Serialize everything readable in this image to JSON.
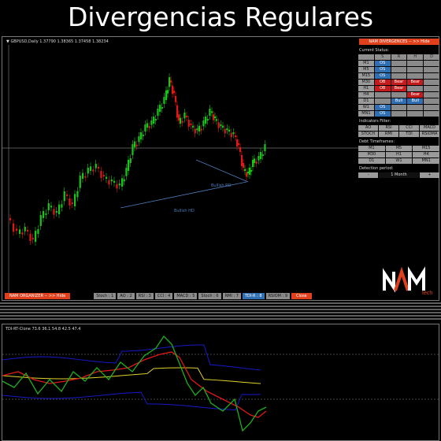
{
  "header": {
    "title": "Divergencias Regulares"
  },
  "chart": {
    "symbol_line": "GBPUSD,Daily  1.37790 1.38365 1.37458 1.38234",
    "annotations": [
      "Bullish RD",
      "Bullish HD"
    ]
  },
  "panel": {
    "title": "NAM DIVERGENCES -- >> Hide",
    "current_status_label": "Current Status:",
    "columns": [
      "",
      "S",
      "R",
      "H",
      "D"
    ],
    "rows": [
      {
        "tf": "M1",
        "cells": [
          "OS",
          "",
          "",
          ""
        ]
      },
      {
        "tf": "M5",
        "cells": [
          "OS",
          "",
          "",
          ""
        ]
      },
      {
        "tf": "M15",
        "cells": [
          "OS",
          "",
          "",
          ""
        ]
      },
      {
        "tf": "M30",
        "cells": [
          "OB",
          "Bear",
          "Bear",
          ""
        ]
      },
      {
        "tf": "H1",
        "cells": [
          "OB",
          "Bear",
          "",
          ""
        ]
      },
      {
        "tf": "H4",
        "cells": [
          "",
          "",
          "Bear",
          ""
        ]
      },
      {
        "tf": "D1",
        "cells": [
          "",
          "Bull",
          "Bull",
          ""
        ]
      },
      {
        "tf": "W1",
        "cells": [
          "OS",
          "",
          "",
          ""
        ]
      },
      {
        "tf": "MN1",
        "cells": [
          "OS",
          "",
          "",
          ""
        ]
      }
    ],
    "filter_label": "Indicators Filter:",
    "filters": [
      "AO",
      "RSI",
      "CCI",
      "MACD",
      "STOCH",
      "RMI",
      "TDI",
      "RSIOMA"
    ],
    "debt_label": "Debt Timeframes:",
    "timeframes": [
      "M1",
      "M5",
      "M15",
      "M30",
      "H1",
      "H4",
      "D1",
      "W1",
      "MN1"
    ],
    "period_label": "Detection period:",
    "period_minus": "-",
    "period_value": "1 Month",
    "period_plus": "+"
  },
  "bottom_buttons": [
    {
      "label": "NAM ORGANIZER -- >> Hide",
      "style": "org"
    },
    {
      "label": "",
      "style": "spacer"
    },
    {
      "label": "Stoch : 1",
      "style": ""
    },
    {
      "label": "AO : 2",
      "style": ""
    },
    {
      "label": "RSI : 3",
      "style": ""
    },
    {
      "label": "CCI : 4",
      "style": ""
    },
    {
      "label": "MACD : 5",
      "style": ""
    },
    {
      "label": "Stoch : 6",
      "style": ""
    },
    {
      "label": "RMI : 7",
      "style": ""
    },
    {
      "label": "TDI-R : 8",
      "style": "sel"
    },
    {
      "label": "RSIOM : 9",
      "style": ""
    },
    {
      "label": "Close",
      "style": "org"
    }
  ],
  "logo": {
    "text": "NAM",
    "sub": "tech"
  },
  "subwindow": {
    "label": "TDI-RT-Clone 73.6 36.1 54.8 42.5 47.4"
  },
  "colors": {
    "bull_candle": "#19c519",
    "bear_candle": "#e01818",
    "accent": "#e0411c",
    "blue_button": "#2f6fb2",
    "divergence_line": "#4f7dbd",
    "tdi_green": "#1fb01f",
    "tdi_red": "#e01818",
    "tdi_yellow": "#e0d02a",
    "tdi_blue": "#1818c8"
  }
}
